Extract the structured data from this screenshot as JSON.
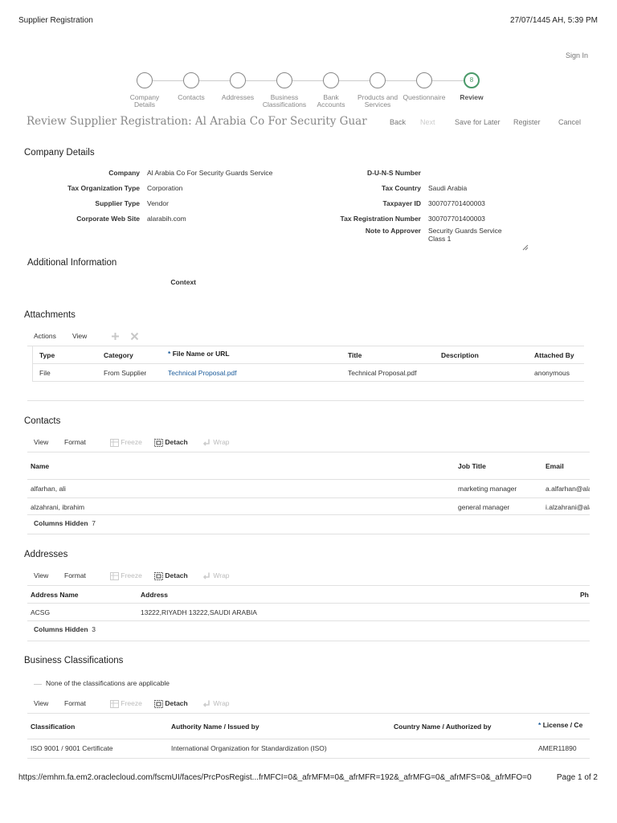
{
  "print_header": {
    "title": "Supplier Registration",
    "datetime": "27/07/1445 AH, 5:39 PM"
  },
  "print_footer": {
    "url": "https://emhm.fa.em2.oraclecloud.com/fscmUI/faces/PrcPosRegist...frMFCI=0&_afrMFM=0&_afrMFR=192&_afrMFG=0&_afrMFS=0&_afrMFO=0",
    "page": "Page 1 of 2"
  },
  "header": {
    "signin": "Sign In"
  },
  "train": {
    "current_index": "8",
    "steps": [
      {
        "line1": "Company",
        "line2": "Details"
      },
      {
        "line1": "Contacts",
        "line2": ""
      },
      {
        "line1": "Addresses",
        "line2": ""
      },
      {
        "line1": "Business",
        "line2": "Classifications"
      },
      {
        "line1": "Bank",
        "line2": "Accounts"
      },
      {
        "line1": "Products and",
        "line2": "Services"
      },
      {
        "line1": "Questionnaire",
        "line2": ""
      },
      {
        "line1": "Review",
        "line2": ""
      }
    ]
  },
  "page_title": "Review Supplier Registration: Al Arabia Co For Security Guar",
  "toolbar": {
    "back": "Back",
    "next": "Next",
    "save_later": "Save for Later",
    "register": "Register",
    "cancel": "Cancel"
  },
  "company_details": {
    "title": "Company Details",
    "company_label": "Company",
    "company": "Al Arabia Co For Security Guards Service",
    "tax_org_label": "Tax Organization Type",
    "tax_org": "Corporation",
    "supplier_type_label": "Supplier Type",
    "supplier_type": "Vendor",
    "website_label": "Corporate Web Site",
    "website": "alarabih.com",
    "duns_label": "D-U-N-S Number",
    "duns": "",
    "tax_country_label": "Tax Country",
    "tax_country": "Saudi Arabia",
    "taxpayer_id_label": "Taxpayer ID",
    "taxpayer_id": "300707701400003",
    "tax_reg_label": "Tax Registration Number",
    "tax_reg": "300707701400003",
    "note_label": "Note to Approver",
    "note_line1": "Security Guards Service",
    "note_line2": "Class 1"
  },
  "additional_info": {
    "title": "Additional Information",
    "context_label": "Context"
  },
  "attachments": {
    "title": "Attachments",
    "actions": "Actions",
    "view": "View",
    "headers": {
      "type": "Type",
      "category": "Category",
      "required": "*",
      "file": "File Name or URL",
      "title": "Title",
      "description": "Description",
      "attached_by": "Attached By"
    },
    "rows": [
      {
        "type": "File",
        "category": "From Supplier",
        "file": "Technical Proposal.pdf",
        "title": "Technical Proposal.pdf",
        "description": "",
        "attached_by": "anonymous"
      }
    ]
  },
  "contacts": {
    "title": "Contacts",
    "view": "View",
    "format": "Format",
    "freeze": "Freeze",
    "detach": "Detach",
    "wrap": "Wrap",
    "headers": {
      "name": "Name",
      "job": "Job Title",
      "email": "Email"
    },
    "rows": [
      {
        "name": "alfarhan, ali",
        "job": "marketing manager",
        "email": "a.alfarhan@ala"
      },
      {
        "name": "alzahrani, ibrahim",
        "job": "general manager",
        "email": "i.alzahrani@ala"
      }
    ],
    "columns_hidden_label": "Columns Hidden",
    "columns_hidden": "7"
  },
  "addresses": {
    "title": "Addresses",
    "view": "View",
    "format": "Format",
    "freeze": "Freeze",
    "detach": "Detach",
    "wrap": "Wrap",
    "headers": {
      "name": "Address Name",
      "address": "Address",
      "phone": "Ph"
    },
    "rows": [
      {
        "name": "ACSG",
        "address": "13222,RIYADH 13222,SAUDI ARABIA"
      }
    ],
    "columns_hidden_label": "Columns Hidden",
    "columns_hidden": "3"
  },
  "business_classifications": {
    "title": "Business Classifications",
    "none_applicable": "None of the classifications are applicable",
    "view": "View",
    "format": "Format",
    "freeze": "Freeze",
    "detach": "Detach",
    "wrap": "Wrap",
    "headers": {
      "classification": "Classification",
      "authority": "Authority Name / Issued by",
      "country": "Country Name / Authorized by",
      "required": "*",
      "license": "License / Ce"
    },
    "rows": [
      {
        "classification": "ISO 9001 / 9001 Certificate",
        "authority": "International Organization for Standardization (ISO)",
        "country": "",
        "license": "AMER11890"
      }
    ]
  },
  "colors": {
    "accent_green": "#4a9a6a",
    "link_blue": "#1a5a9a",
    "required_blue": "#1a5a9a"
  }
}
